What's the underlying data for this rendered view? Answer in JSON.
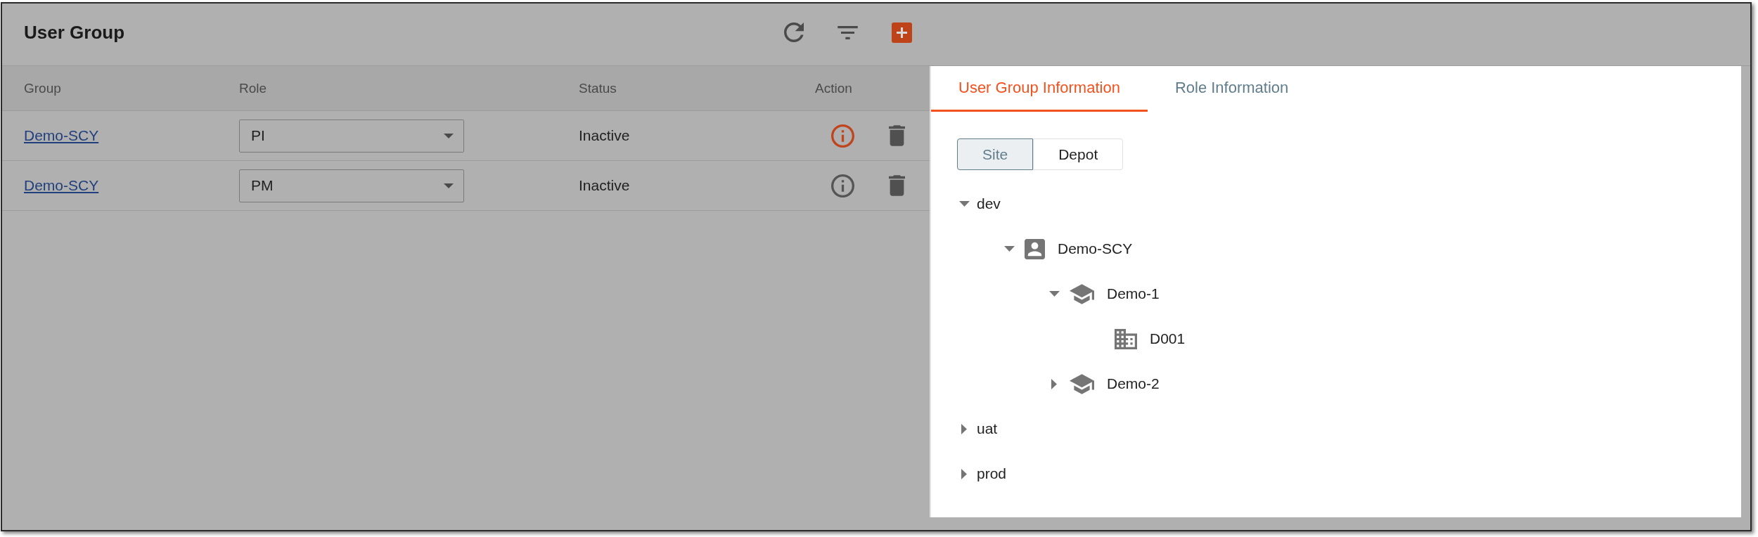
{
  "header": {
    "title": "User Group"
  },
  "table": {
    "columns": [
      "Group",
      "Role",
      "Status",
      "Action"
    ],
    "rows": [
      {
        "group": "Demo-SCY",
        "role": "PI",
        "status": "Inactive",
        "selected": true
      },
      {
        "group": "Demo-SCY",
        "role": "PM",
        "status": "Inactive",
        "selected": false
      }
    ]
  },
  "panel": {
    "tabs": [
      {
        "label": "User Group Information",
        "selected": true
      },
      {
        "label": "Role Information",
        "selected": false
      }
    ],
    "toggle": [
      {
        "label": "Site",
        "selected": true
      },
      {
        "label": "Depot",
        "selected": false
      }
    ],
    "tree": [
      {
        "label": "dev",
        "kind": "plain",
        "expanded": true,
        "children": [
          {
            "label": "Demo-SCY",
            "kind": "person",
            "expanded": true,
            "children": [
              {
                "label": "Demo-1",
                "kind": "cap",
                "expanded": true,
                "children": [
                  {
                    "label": "D001",
                    "kind": "building"
                  }
                ]
              },
              {
                "label": "Demo-2",
                "kind": "cap",
                "expanded": false
              }
            ]
          }
        ]
      },
      {
        "label": "uat",
        "kind": "plain",
        "expanded": false
      },
      {
        "label": "prod",
        "kind": "plain",
        "expanded": false
      }
    ]
  }
}
